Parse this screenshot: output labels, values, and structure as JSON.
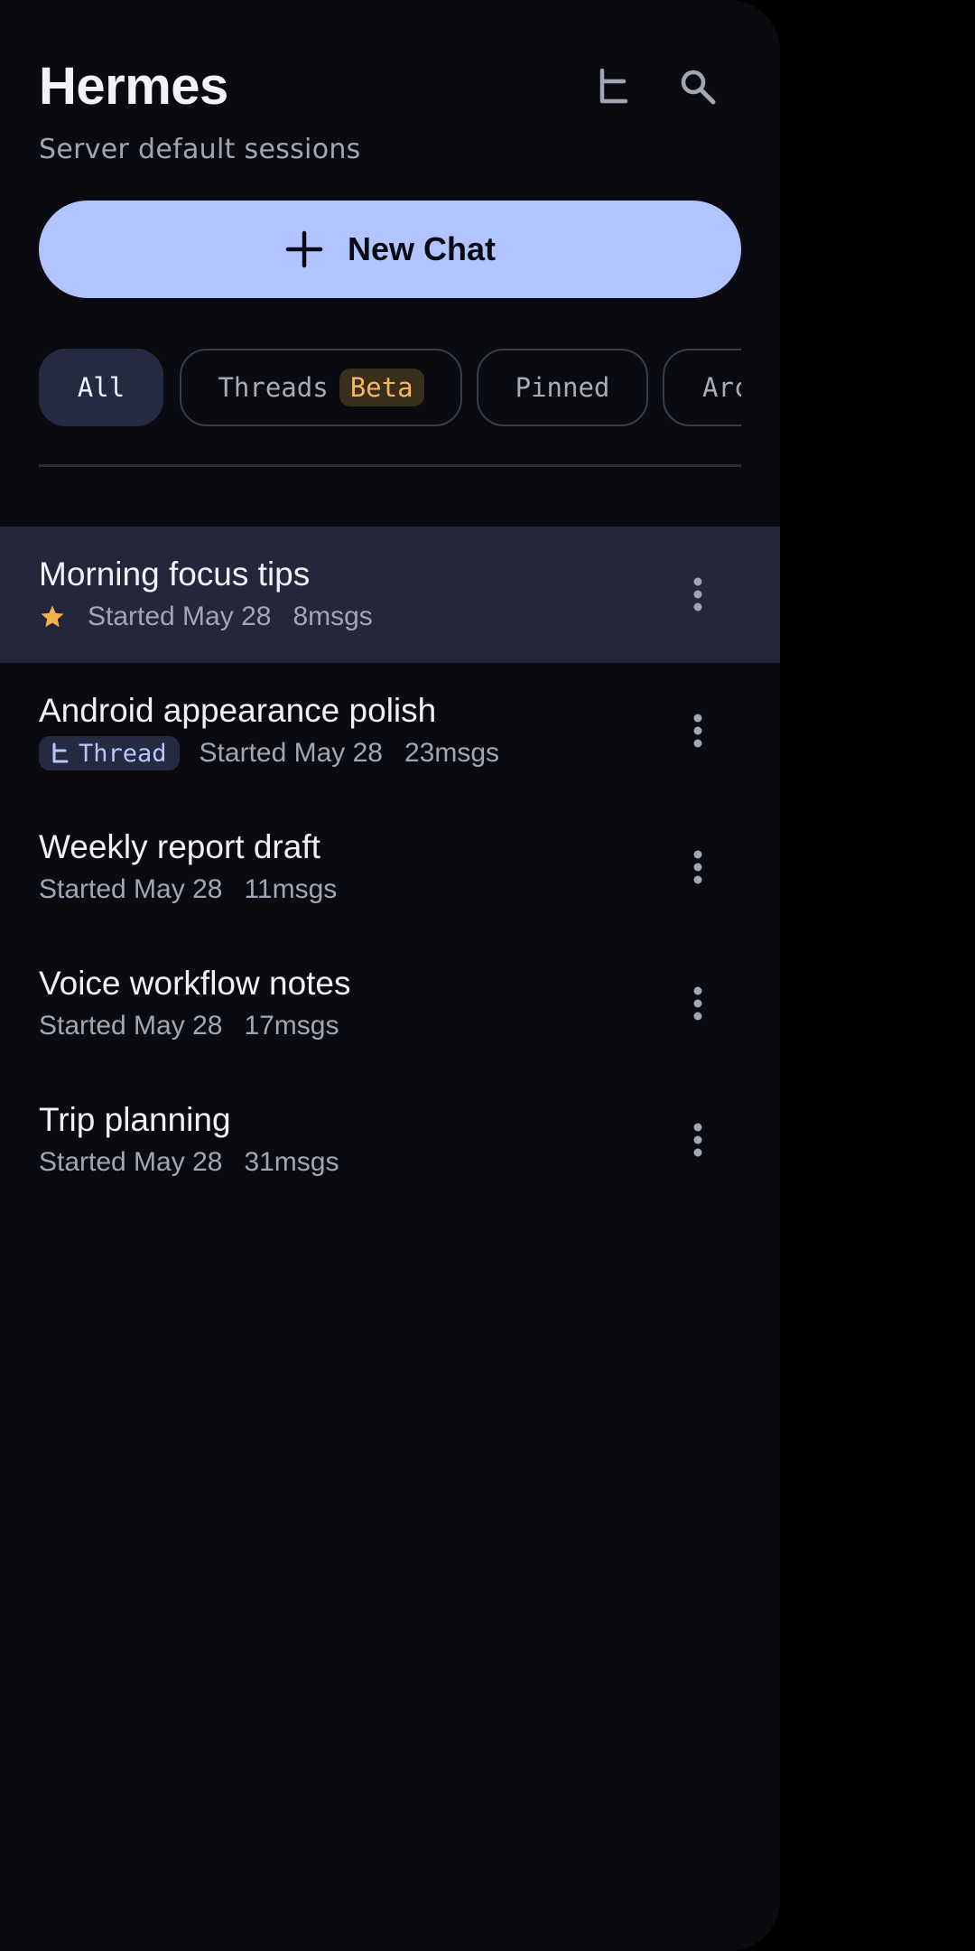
{
  "header": {
    "title": "Hermes",
    "subtitle": "Server default sessions",
    "icons": [
      "thread-icon",
      "search-icon"
    ]
  },
  "new_chat": {
    "label": "New Chat",
    "icon": "plus-icon"
  },
  "filters": {
    "selected": "All",
    "chips": [
      {
        "label": "All"
      },
      {
        "label": "Threads",
        "badge": "Beta"
      },
      {
        "label": "Pinned"
      },
      {
        "label": "Archived"
      }
    ]
  },
  "sessions": [
    {
      "title": "Morning focus tips",
      "started": "Started May 28",
      "count": "8msgs",
      "starred": true,
      "selected": true
    },
    {
      "title": "Android appearance polish",
      "tag": "Thread",
      "started": "Started May 28",
      "count": "23msgs"
    },
    {
      "title": "Weekly report draft",
      "started": "Started May 28",
      "count": "11msgs"
    },
    {
      "title": "Voice workflow notes",
      "started": "Started May 28",
      "count": "17msgs"
    },
    {
      "title": "Trip planning",
      "started": "Started May 28",
      "count": "31msgs"
    }
  ],
  "colors": {
    "background": "#0a0b10",
    "accent": "#b2c4ff",
    "selected_row": "#24273c",
    "star": "#f2b14c",
    "beta_badge": "#f2b760"
  }
}
